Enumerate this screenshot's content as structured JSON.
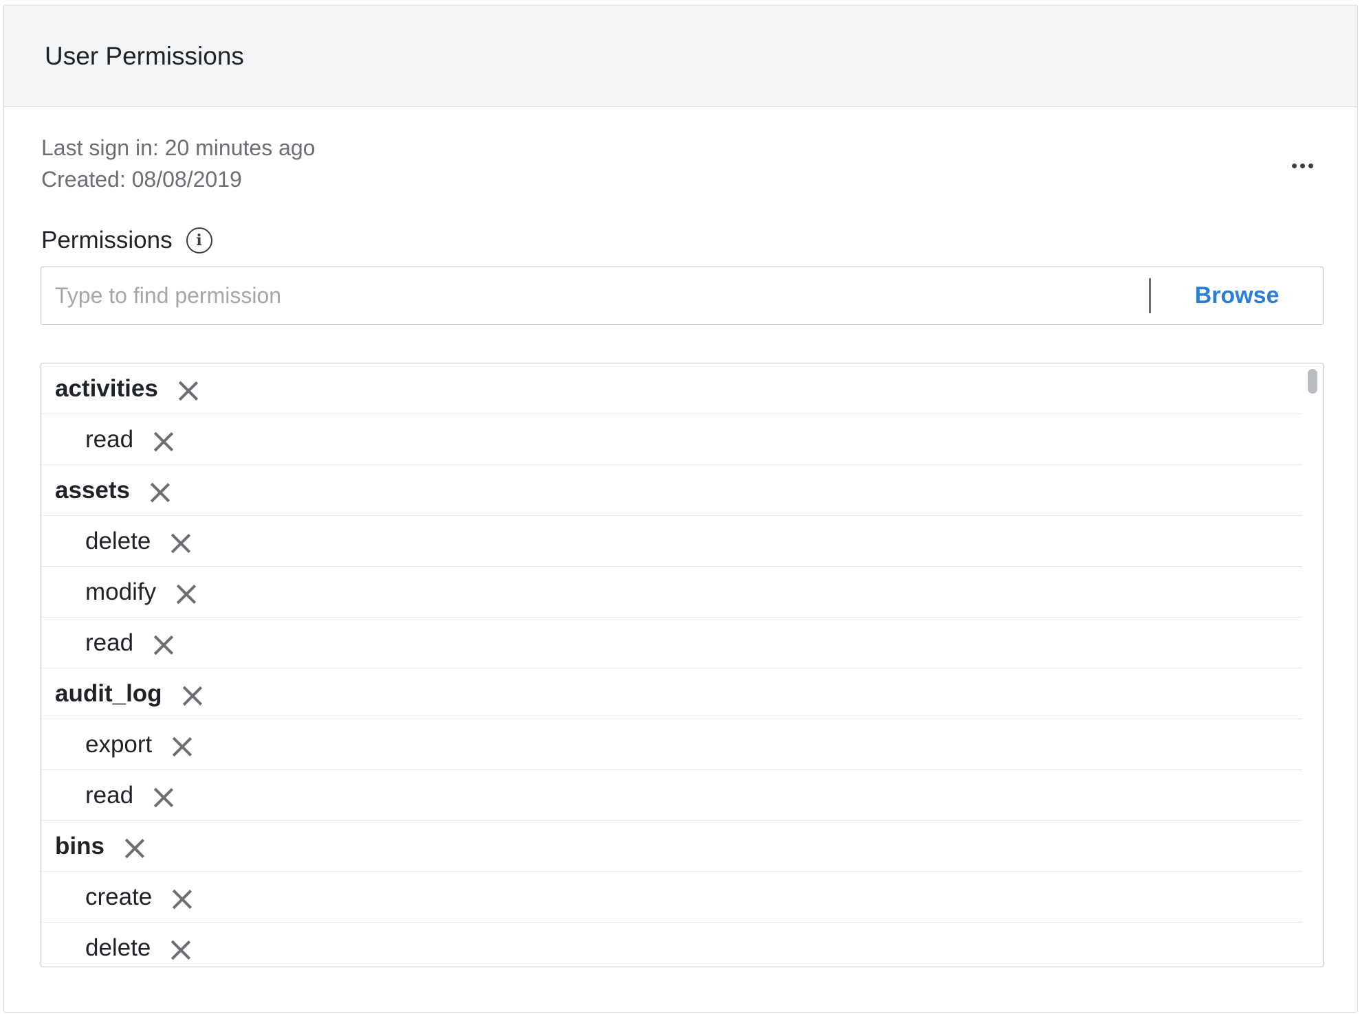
{
  "header": {
    "title": "User Permissions"
  },
  "meta": {
    "last_sign_in": "Last sign in: 20 minutes ago",
    "created": "Created: 08/08/2019"
  },
  "permissions": {
    "label": "Permissions",
    "info_icon": "info-icon",
    "search_placeholder": "Type to find permission",
    "browse_label": "Browse",
    "items": [
      {
        "level": "parent",
        "label": "activities"
      },
      {
        "level": "child",
        "label": "read"
      },
      {
        "level": "parent",
        "label": "assets"
      },
      {
        "level": "child",
        "label": "delete"
      },
      {
        "level": "child",
        "label": "modify"
      },
      {
        "level": "child",
        "label": "read"
      },
      {
        "level": "parent",
        "label": "audit_log"
      },
      {
        "level": "child",
        "label": "export"
      },
      {
        "level": "child",
        "label": "read"
      },
      {
        "level": "parent",
        "label": "bins"
      },
      {
        "level": "child",
        "label": "create"
      },
      {
        "level": "child",
        "label": "delete"
      }
    ]
  },
  "colors": {
    "accent": "#2a7ed3",
    "header_bg": "#f4f5f7",
    "muted_text": "#6b6e73"
  },
  "icons": {
    "more": "more-horizontal-icon",
    "remove": "close-icon"
  }
}
